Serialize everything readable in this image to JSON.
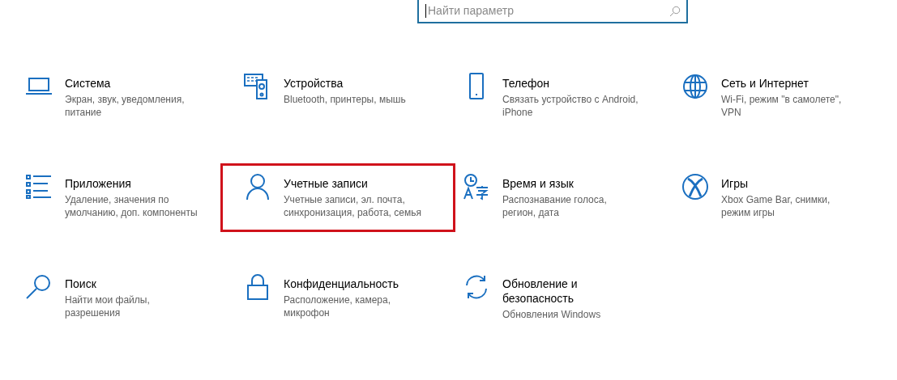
{
  "search": {
    "placeholder": "Найти параметр"
  },
  "categories": [
    {
      "kind": "laptop",
      "title": "Система",
      "description": "Экран, звук, уведомления, питание",
      "highlighted": false
    },
    {
      "kind": "devices",
      "title": "Устройства",
      "description": "Bluetooth, принтеры, мышь",
      "highlighted": false
    },
    {
      "kind": "phone",
      "title": "Телефон",
      "description": "Связать устройство с Android, iPhone",
      "highlighted": false
    },
    {
      "kind": "globe",
      "title": "Сеть и Интернет",
      "description": "Wi-Fi, режим \"в самолете\", VPN",
      "highlighted": false
    },
    {
      "kind": "list",
      "title": "Приложения",
      "description": "Удаление, значения по умолчанию, доп. компоненты",
      "highlighted": false
    },
    {
      "kind": "person",
      "title": "Учетные записи",
      "description": "Учетные записи, эл. почта, синхронизация, работа, семья",
      "highlighted": true
    },
    {
      "kind": "language",
      "title": "Время и язык",
      "description": "Распознавание голоса, регион, дата",
      "highlighted": false
    },
    {
      "kind": "xbox",
      "title": "Игры",
      "description": "Xbox Game Bar, снимки, режим игры",
      "highlighted": false
    },
    {
      "kind": "search",
      "title": "Поиск",
      "description": "Найти мои файлы, разрешения",
      "highlighted": false
    },
    {
      "kind": "lock",
      "title": "Конфиденциальность",
      "description": "Расположение, камера, микрофон",
      "highlighted": false
    },
    {
      "kind": "sync",
      "title": "Обновление и безопасность",
      "description": "Обновления Windows",
      "highlighted": false
    }
  ]
}
